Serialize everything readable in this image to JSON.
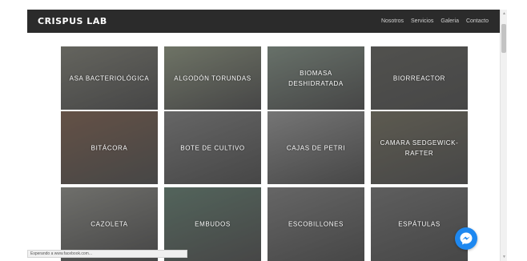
{
  "header": {
    "brand": "CRISPUS LAB",
    "nav": [
      "Nosotros",
      "Servicios",
      "Galeria",
      "Contacto"
    ]
  },
  "products": [
    {
      "label": "ASA BACTERIOLÓGICA",
      "color": "#8a8a80"
    },
    {
      "label": "ALGODÓN TORUNDAS",
      "color": "#9aa28c"
    },
    {
      "label": "BIOMASA DESHIDRATADA",
      "color": "#8f9e92"
    },
    {
      "label": "BIORREACTOR",
      "color": "#6b6b66"
    },
    {
      "label": "BITÁCORA",
      "color": "#8a6b5a"
    },
    {
      "label": "BOTE DE CULTIVO",
      "color": "#8c8c8c"
    },
    {
      "label": "CAJAS DE PETRI",
      "color": "#a5a5a5"
    },
    {
      "label": "CAMARA SEDGEWICK-RAFTER",
      "color": "#7e7a6a"
    },
    {
      "label": "CAZOLETA",
      "color": "#9b9b95"
    },
    {
      "label": "EMBUDOS",
      "color": "#6e8a7c"
    },
    {
      "label": "ESCOBILLONES",
      "color": "#8c8c8c"
    },
    {
      "label": "ESPÁTULAS",
      "color": "#808080"
    }
  ],
  "status": {
    "text": "Esperando a www.facebook.com..."
  },
  "colors": {
    "navbar": "#2b2b2b",
    "messenger": "#1e88f0"
  }
}
